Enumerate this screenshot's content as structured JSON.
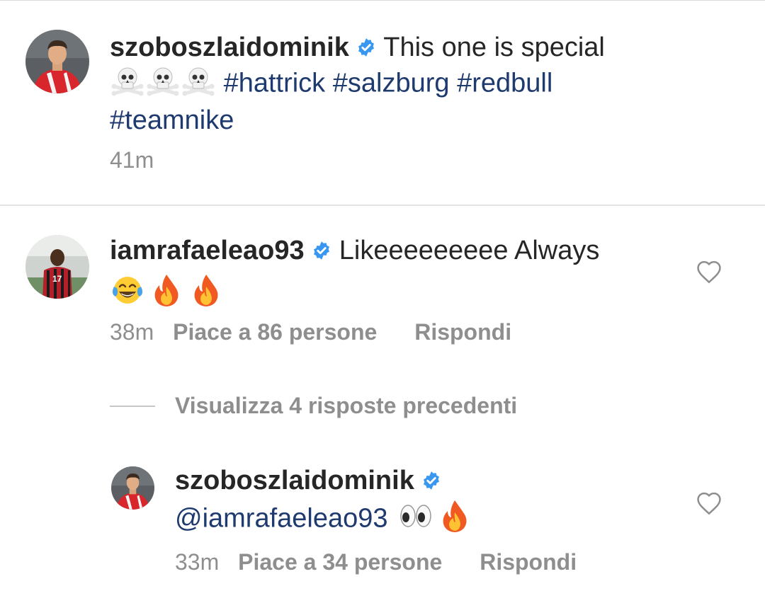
{
  "caption": {
    "username": "szoboszlaidominik",
    "text": "This one is special",
    "emojis": [
      "skull-and-crossbones",
      "skull-and-crossbones",
      "skull-and-crossbones"
    ],
    "hashtags": [
      "#hattrick",
      "#salzburg",
      "#redbull",
      "#teamnike"
    ],
    "time": "41m"
  },
  "comment": {
    "username": "iamrafaeleao93",
    "text": "Likeeeeeeeee Always",
    "emojis": [
      "face-with-tears-of-joy",
      "fire",
      "fire"
    ],
    "time": "38m",
    "likes": "Piace a 86 persone",
    "reply_label": "Rispondi"
  },
  "view_replies": "Visualizza 4 risposte precedenti",
  "reply": {
    "username": "szoboszlaidominik",
    "mention": "@iamrafaeleao93",
    "emojis": [
      "eyes",
      "fire"
    ],
    "time": "33m",
    "likes": "Piace a 34 persone",
    "reply_label": "Rispondi"
  },
  "colors": {
    "verified": "#3897f0",
    "hashtag": "#1e3a6e",
    "meta": "#8e8e8e",
    "text": "#262626"
  }
}
